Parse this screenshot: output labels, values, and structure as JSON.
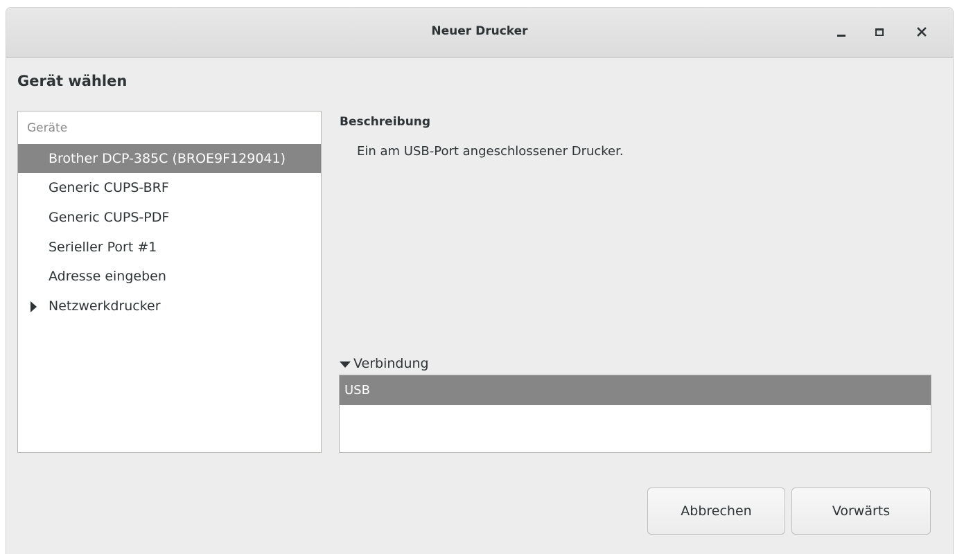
{
  "window": {
    "title": "Neuer Drucker",
    "controls": [
      "minimize",
      "maximize",
      "close"
    ]
  },
  "heading": "Gerät wählen",
  "devices": {
    "header": "Geräte",
    "items": [
      {
        "label": "Brother DCP-385C (BROE9F129041)",
        "selected": true
      },
      {
        "label": "Generic CUPS-BRF",
        "selected": false
      },
      {
        "label": "Generic CUPS-PDF",
        "selected": false
      },
      {
        "label": "Serieller Port #1",
        "selected": false
      },
      {
        "label": "Adresse eingeben",
        "selected": false
      },
      {
        "label": "Netzwerkdrucker",
        "selected": false,
        "expandable": true,
        "expanded": false
      }
    ]
  },
  "description": {
    "title": "Beschreibung",
    "text": "Ein am USB-Port angeschlossener Drucker."
  },
  "connection": {
    "label": "Verbindung",
    "expanded": true,
    "items": [
      {
        "label": "USB",
        "selected": true
      }
    ]
  },
  "buttons": {
    "cancel": "Abbrechen",
    "forward": "Vorwärts"
  },
  "colors": {
    "selection": "#868686",
    "background": "#ededed",
    "text": "#2e3436"
  }
}
